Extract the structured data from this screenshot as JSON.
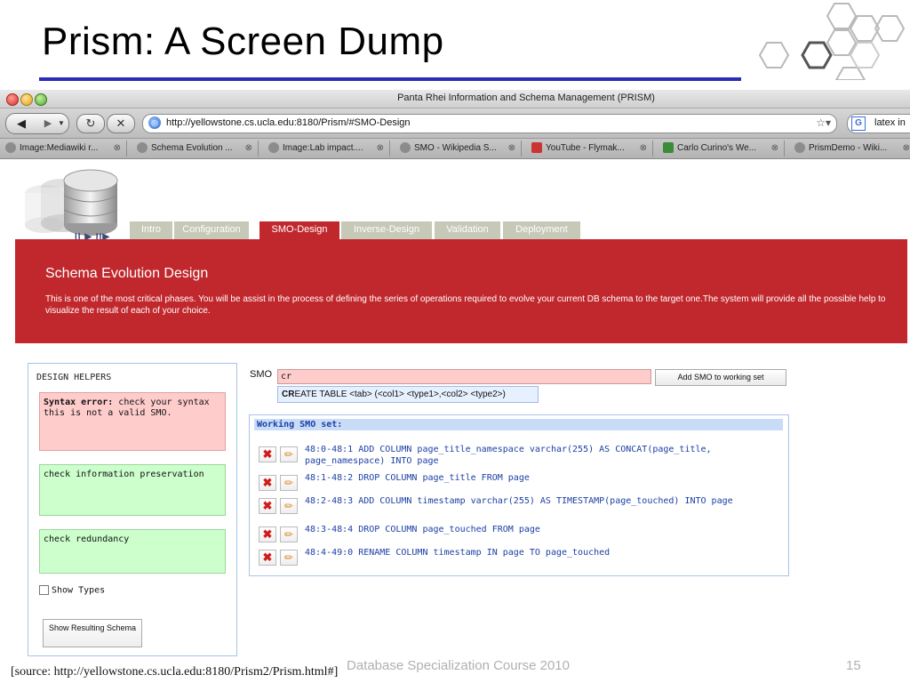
{
  "slide": {
    "title": "Prism: A Screen Dump",
    "source": "[source: http://yellowstone.cs.ucla.edu:8180/Prism2/Prism.html#]",
    "course": "Database Specialization Course 2010",
    "page_number": "15",
    "accent_color": "#2b2bb8"
  },
  "browser": {
    "window_title": "Panta Rhei Information and Schema Management (PRISM)",
    "url": "http://yellowstone.cs.ucla.edu:8180/Prism/#SMO-Design",
    "search_text": "latex in",
    "tabs": [
      {
        "label": "Image:Mediawiki r...",
        "icon": "globe-icon"
      },
      {
        "label": "Schema Evolution ...",
        "icon": "globe-icon"
      },
      {
        "label": "Image:Lab impact....",
        "icon": "globe-icon"
      },
      {
        "label": "SMO - Wikipedia S...",
        "icon": "globe-icon"
      },
      {
        "label": "YouTube - Flymak...",
        "icon": "youtube-icon"
      },
      {
        "label": "Carlo Curino's We...",
        "icon": "site-icon"
      },
      {
        "label": "PrismDemo - Wiki...",
        "icon": "globe-icon"
      }
    ]
  },
  "app": {
    "logo_caption": "II ▶ II▶",
    "tabs": [
      {
        "label": "Intro",
        "active": false
      },
      {
        "label": "Configuration",
        "active": false
      },
      {
        "label": "SMO-Design",
        "active": true
      },
      {
        "label": "Inverse-Design",
        "active": false
      },
      {
        "label": "Validation",
        "active": false
      },
      {
        "label": "Deployment",
        "active": false
      }
    ],
    "banner_title": "Schema Evolution Design",
    "banner_text": "This is one of the most critical phases. You will be assist in the process of defining the series of operations required to evolve your current DB schema to the target one.The system will provide all the possible help to visualize the result of each of your choice.",
    "banner_color": "#c1282d",
    "helpers": {
      "title": "DESIGN HELPERS",
      "error_label": "Syntax error:",
      "error_text": " check your syntax this is not a valid SMO.",
      "check_info": "check information preservation",
      "check_redundancy": "check redundancy",
      "show_types": "Show Types",
      "show_result_button": "Show Resulting Schema"
    },
    "smo": {
      "label": "SMO",
      "input_value": "cr",
      "add_button": "Add SMO to working set",
      "suggestion_bold": "CR",
      "suggestion_rest": "EATE TABLE <tab> (<col1> <type1>,<col2> <type2>)"
    },
    "working_set": {
      "title": "Working SMO set:",
      "items": [
        "48:0-48:1 ADD COLUMN page_title_namespace varchar(255) AS CONCAT(page_title, page_namespace) INTO page",
        "48:1-48:2 DROP COLUMN page_title FROM page",
        "48:2-48:3 ADD COLUMN timestamp varchar(255) AS TIMESTAMP(page_touched) INTO page",
        "48:3-48:4 DROP COLUMN page_touched FROM page",
        "48:4-49:0 RENAME COLUMN timestamp IN page TO page_touched"
      ]
    }
  }
}
